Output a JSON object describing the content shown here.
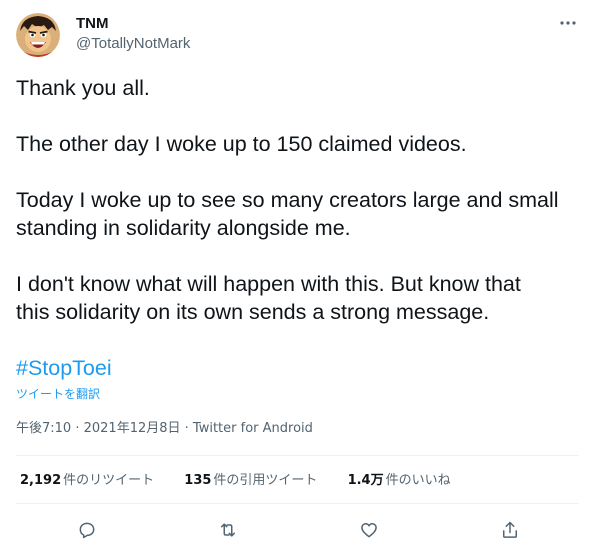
{
  "tweet": {
    "author": {
      "display_name": "TNM",
      "handle": "@TotallyNotMark",
      "avatar_icon": "avatar-cartoon-pirate"
    },
    "body": {
      "p1": "Thank you all.",
      "p2": "The other day I woke up to 150 claimed videos.",
      "p3_line1": "Today I woke up to see so many creators large and small",
      "p3_line2": "standing in solidarity alongside me.",
      "p4_line1": "I don't know what will happen with this. But know that",
      "p4_line2": "this solidarity on its own sends a strong message.",
      "hashtag": "#StopToei"
    },
    "translate_label": "ツイートを翻訳",
    "meta": {
      "time": "午後7:10",
      "sep1": " · ",
      "date": "2021年12月8日",
      "sep2": " · ",
      "source": "Twitter for Android"
    },
    "stats": {
      "retweets_count": "2,192",
      "retweets_label": "件のリツイート",
      "quotes_count": "135",
      "quotes_label": "件の引用ツイート",
      "likes_count": "1.4万",
      "likes_label": "件のいいね"
    },
    "actions": [
      "reply-icon",
      "retweet-icon",
      "like-icon",
      "share-icon"
    ]
  },
  "colors": {
    "text_primary": "#0f1419",
    "text_secondary": "#536471",
    "accent": "#1d9bf0",
    "divider": "#eff3f4"
  }
}
